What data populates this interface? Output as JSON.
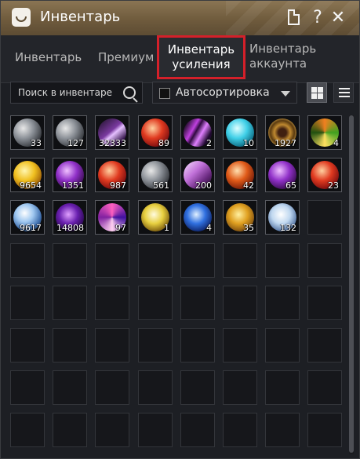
{
  "window": {
    "title": "Инвентарь"
  },
  "title_buttons": {
    "help": "?",
    "close": "✕"
  },
  "tabs": [
    {
      "label": "Инвентарь",
      "active": false
    },
    {
      "label": "Премиум",
      "active": false
    },
    {
      "label": "Инвентарь усиления",
      "active": true
    },
    {
      "label": "Инвентарь аккаунта",
      "active": false
    }
  ],
  "search": {
    "placeholder": "Поиск в инвентаре"
  },
  "sort": {
    "label": "Автосортировка",
    "checked": false
  },
  "view": {
    "mode": "grid"
  },
  "colors": {
    "accent_red": "#d4202a",
    "title_bar": "#6f5b3d"
  },
  "items": [
    {
      "icon": "gray-stone-icon",
      "count": "33"
    },
    {
      "icon": "gray-stone-icon",
      "count": "127"
    },
    {
      "icon": "purple-shard-icon",
      "count": "32333"
    },
    {
      "icon": "red-stone-icon",
      "count": "89"
    },
    {
      "icon": "purple-claw-icon",
      "count": "2"
    },
    {
      "icon": "cyan-orb-icon",
      "count": "10"
    },
    {
      "icon": "gold-medallion-icon",
      "count": "1927"
    },
    {
      "icon": "green-vortex-icon",
      "count": "4"
    },
    {
      "icon": "gold-stone-icon",
      "count": "9654"
    },
    {
      "icon": "purple-stone-icon",
      "count": "1351"
    },
    {
      "icon": "red-stone-icon",
      "count": "987"
    },
    {
      "icon": "gray-stone-icon",
      "count": "561"
    },
    {
      "icon": "pink-crystal-icon",
      "count": "200"
    },
    {
      "icon": "orange-stone-icon",
      "count": "42"
    },
    {
      "icon": "purple-stone-icon",
      "count": "65"
    },
    {
      "icon": "red-stone-icon",
      "count": "23"
    },
    {
      "icon": "blue-crystal-icon",
      "count": "9617"
    },
    {
      "icon": "purple-orb-icon",
      "count": "14808"
    },
    {
      "icon": "pink-vortex-icon",
      "count": "97"
    },
    {
      "icon": "yellow-orb-icon",
      "count": "1"
    },
    {
      "icon": "blue-orb-icon",
      "count": "4"
    },
    {
      "icon": "gold-orb-icon",
      "count": "35"
    },
    {
      "icon": "white-orb-icon",
      "count": "132"
    }
  ],
  "grid": {
    "columns": 8,
    "rows": 8
  }
}
